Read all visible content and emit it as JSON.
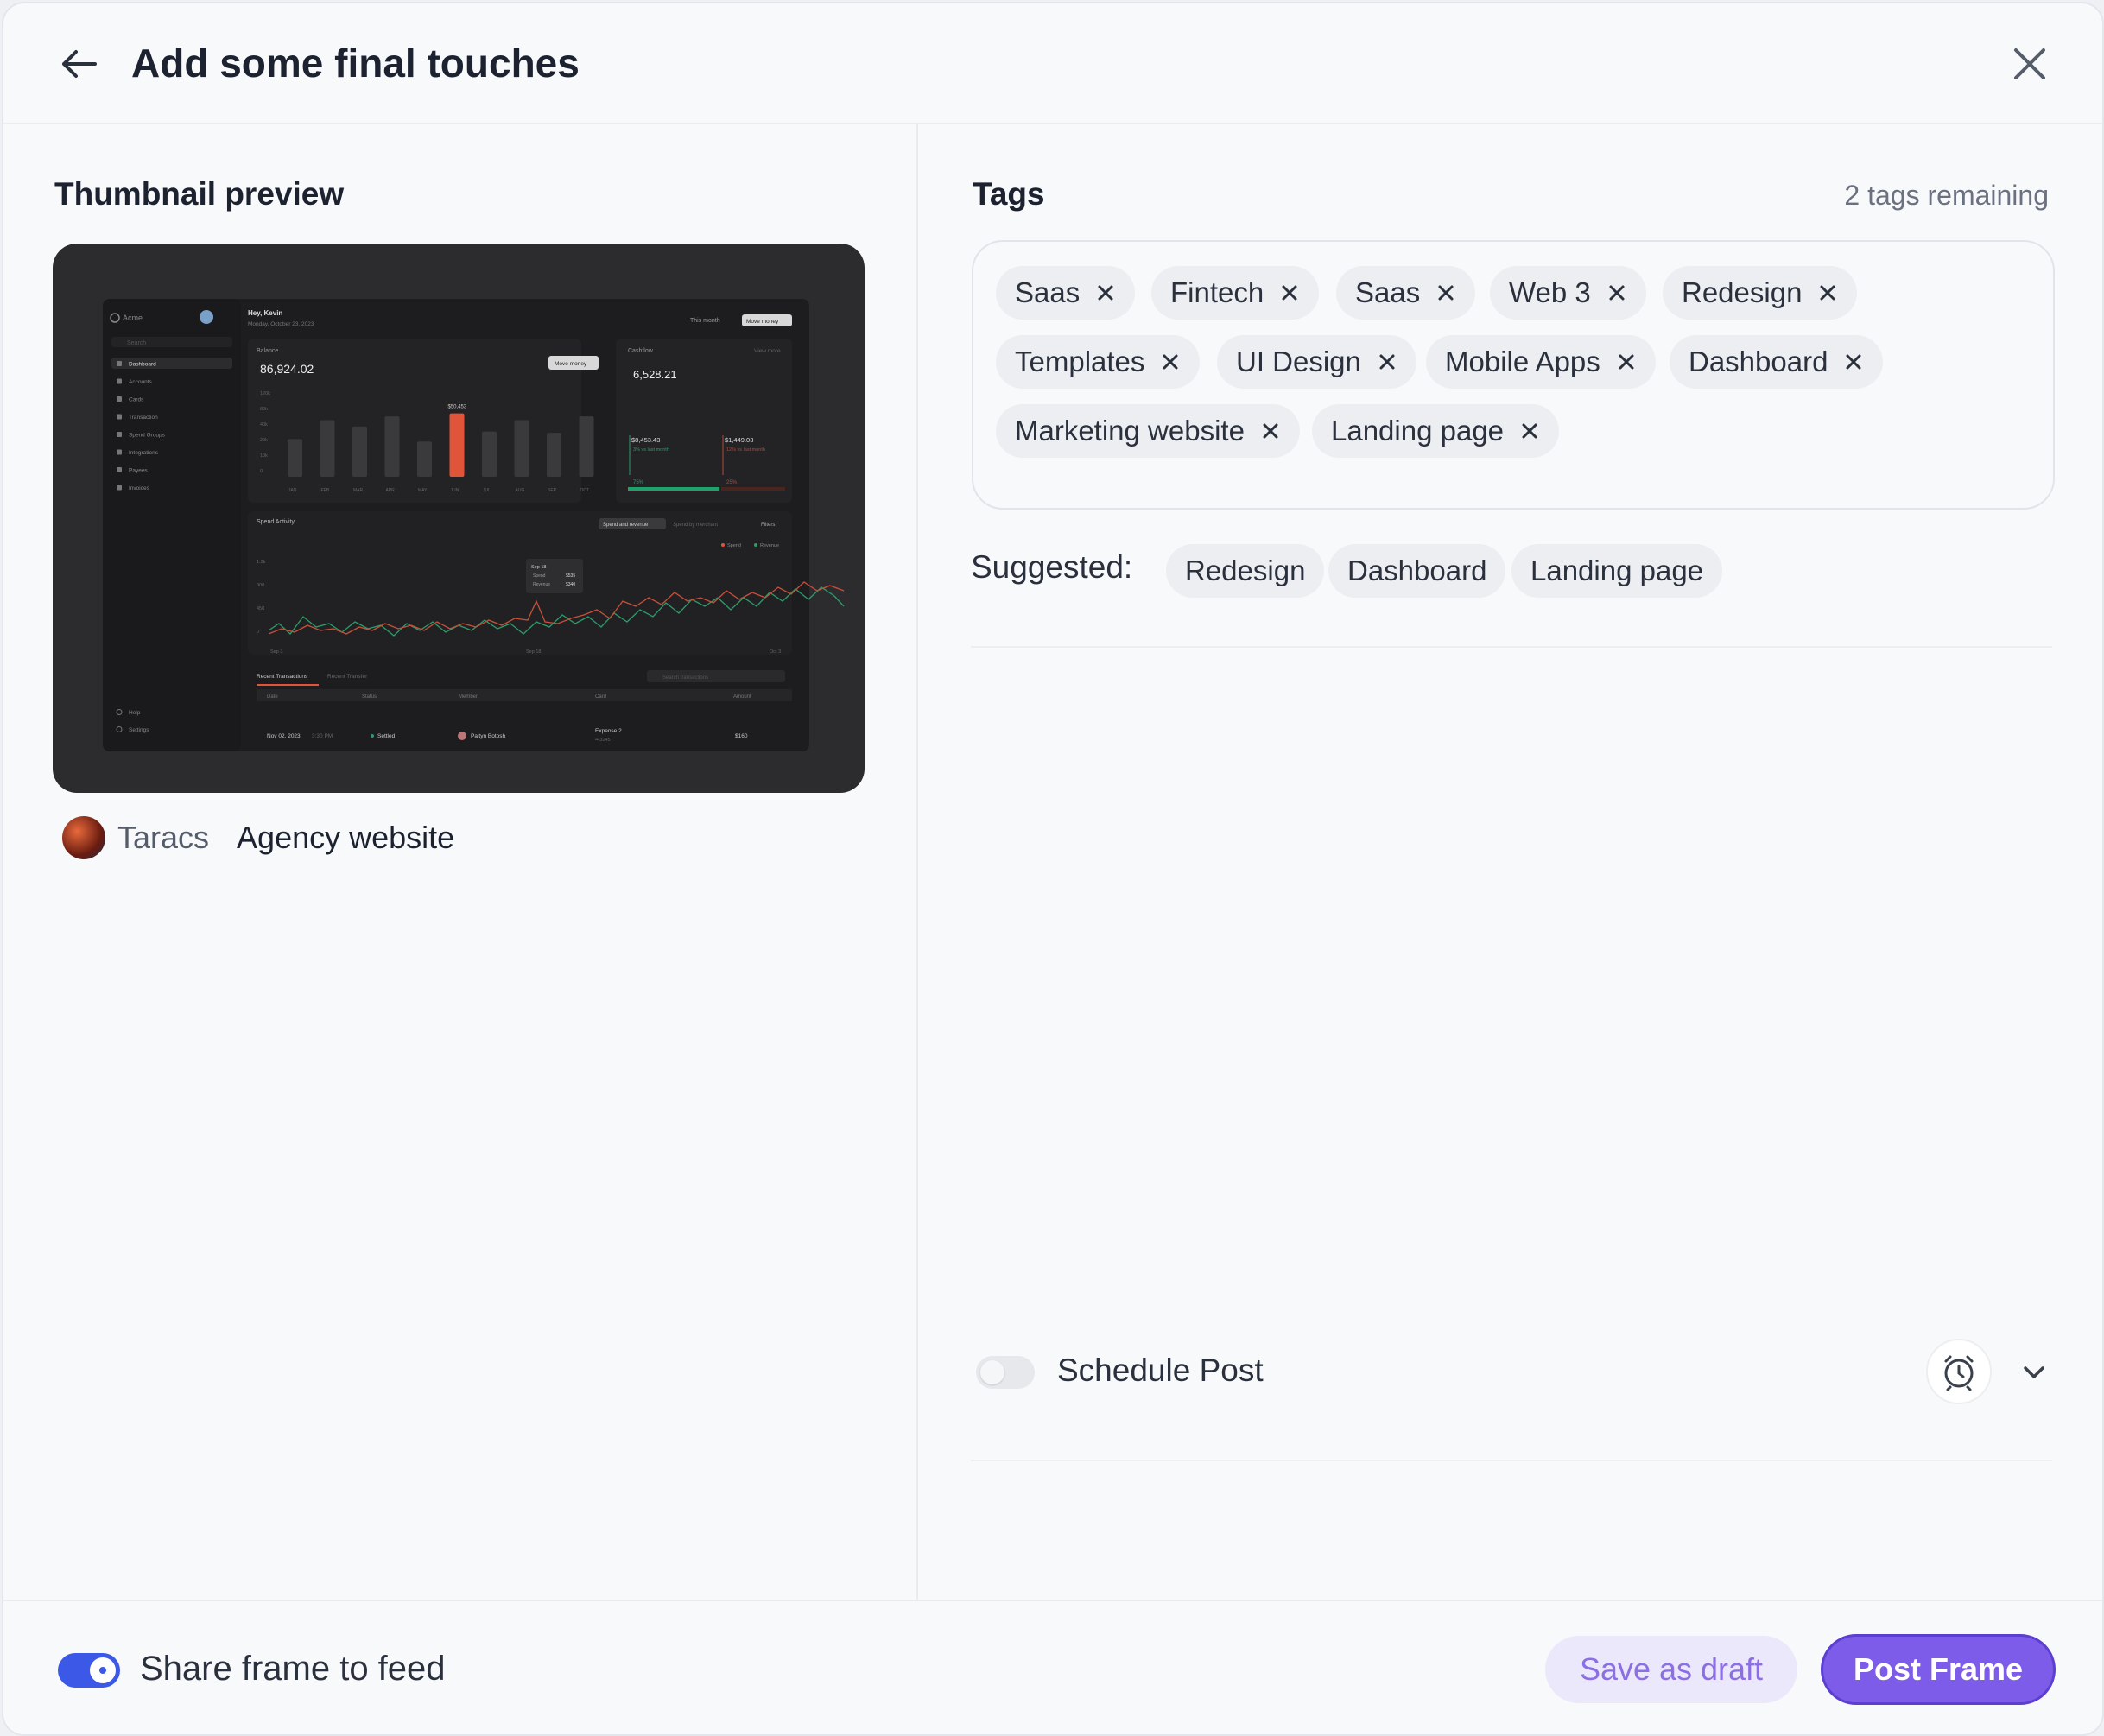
{
  "header": {
    "title": "Add some final touches",
    "back_icon": "arrow-left-icon",
    "close_icon": "close-icon"
  },
  "left": {
    "section_title": "Thumbnail preview",
    "thumbnail": {
      "brand": "Acme",
      "greeting": "Hey, Kevin",
      "date": "Monday, October 23, 2023",
      "period": "This month",
      "move_money": "Move money",
      "search": "Search",
      "nav": [
        "Dashboard",
        "Accounts",
        "Cards",
        "Transaction",
        "Spend Groups",
        "Integrations",
        "Payees",
        "Invoices"
      ],
      "nav_bottom": [
        "Help",
        "Settings"
      ],
      "balance_label": "Balance",
      "balance_value": "86,924.02",
      "cashflow_label": "Cashflow",
      "cashflow_value": "6,528.21",
      "view_more": "View more",
      "cashflow_in": "$8,453.43",
      "cashflow_out": "$1,449.03",
      "in_note": "3% vs last month",
      "out_note": "12% vs last month",
      "pct_in": "75%",
      "pct_out": "25%",
      "bar_peak_label": "$50,453",
      "months": [
        "JAN",
        "FEB",
        "MAR",
        "APR",
        "MAY",
        "JUN",
        "JUL",
        "AUG",
        "SEP",
        "OCT"
      ],
      "y_ticks": [
        "120k",
        "80k",
        "40k",
        "20k",
        "10k",
        "0"
      ],
      "spend_activity": "Spend Activity",
      "spend_tabs": [
        "Spend and revenue",
        "Spend by merchant"
      ],
      "filters": "Filters",
      "legend": [
        "Spend",
        "Revenue"
      ],
      "tooltip": {
        "date": "Sep 18",
        "spend_label": "Spend",
        "spend": "$535",
        "revenue_label": "Revenue",
        "revenue": "$340"
      },
      "spend_y": [
        "1.2k",
        "900",
        "450",
        "0"
      ],
      "spend_x": [
        "Sep 3",
        "Sep 18",
        "Oct 3"
      ],
      "tx_tabs": [
        "Recent Transactions",
        "Recent Transfer"
      ],
      "tx_search": "Search transactions",
      "tx_headers": [
        "Date",
        "Status",
        "Member",
        "Card",
        "Amount"
      ],
      "tx_row": {
        "date": "Nov 02, 2023",
        "time": "3:30 PM",
        "status": "Settled",
        "member": "Paityn Botosh",
        "card": "Expense 2",
        "card_sub": "•• 3245",
        "amount": "$160"
      },
      "chart_data": {
        "type": "bar",
        "categories": [
          "JAN",
          "FEB",
          "MAR",
          "APR",
          "MAY",
          "JUN",
          "JUL",
          "AUG",
          "SEP",
          "OCT"
        ],
        "values": [
          30,
          45,
          40,
          48,
          28,
          50.453,
          36,
          45,
          35,
          48
        ],
        "highlight_index": 5
      }
    },
    "author": {
      "name": "Taracs",
      "project": "Agency website"
    }
  },
  "right": {
    "tags_title": "Tags",
    "remaining": "2 tags remaining",
    "tags": [
      "Saas",
      "Fintech",
      "Saas",
      "Web 3",
      "Redesign",
      "Templates",
      "UI Design",
      "Mobile Apps",
      "Dashboard",
      "Marketing website",
      "Landing page"
    ],
    "suggested_label": "Suggested:",
    "suggested": [
      "Redesign",
      "Dashboard",
      "Landing page"
    ],
    "schedule_label": "Schedule Post",
    "schedule_enabled": false,
    "clock_icon": "alarm-clock-icon",
    "chevron_icon": "chevron-down-icon"
  },
  "footer": {
    "share_label": "Share frame to feed",
    "share_enabled": true,
    "draft_label": "Save as draft",
    "post_label": "Post Frame"
  },
  "colors": {
    "accent": "#7c5ce8",
    "toggle_on": "#3b58e6",
    "draft_bg": "#ece8fb",
    "bar_highlight": "#e0553a"
  }
}
